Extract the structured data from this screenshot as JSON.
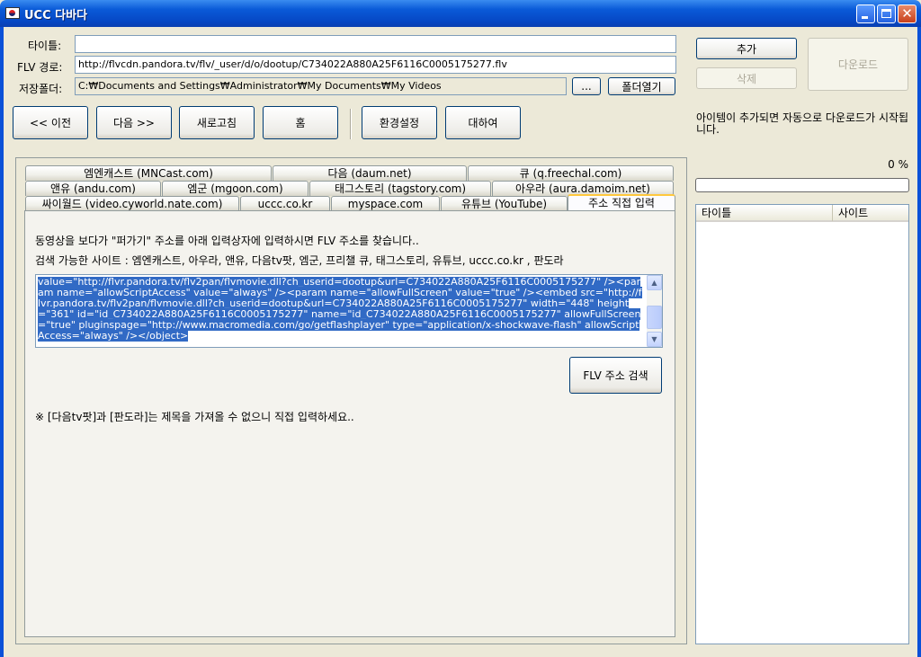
{
  "window": {
    "title": "UCC 다바다",
    "minimize_label": "",
    "maximize_label": "",
    "close_label": "✕"
  },
  "form": {
    "title_label": "타이틀:",
    "title_value": "",
    "flv_label": "FLV 경로:",
    "flv_value": "http://flvcdn.pandora.tv/flv/_user/d/o/dootup/C734022A880A25F6116C0005175277.flv",
    "folder_label": "저장폴더:",
    "folder_value": "C:₩Documents and Settings₩Administrator₩My Documents₩My Videos",
    "browse_label": "...",
    "open_folder_label": "폴더열기"
  },
  "right_panel": {
    "add_label": "추가",
    "delete_label": "삭제",
    "download_label": "다운로드",
    "info_text": "아이템이 추가되면 자동으로 다운로드가 시작됩니다.",
    "progress_text": "0 %",
    "progress_value": 0,
    "list_columns": [
      "타이틀",
      "사이트"
    ]
  },
  "nav": {
    "prev_label": "<< 이전",
    "next_label": "다음 >>",
    "refresh_label": "새로고침",
    "home_label": "홈",
    "settings_label": "환경설정",
    "about_label": "대하여"
  },
  "tabs": {
    "row1": [
      "엠엔캐스트 (MNCast.com)",
      "다음 (daum.net)",
      "큐 (q.freechal.com)"
    ],
    "row2": [
      "앤유 (andu.com)",
      "엠군 (mgoon.com)",
      "태그스토리 (tagstory.com)",
      "아우라 (aura.damoim.net)"
    ],
    "row3": [
      "싸이월드 (video.cyworld.nate.com)",
      "uccc.co.kr",
      "myspace.com",
      "유튜브 (YouTube)",
      "주소 직접 입력"
    ],
    "active": "주소 직접 입력"
  },
  "direct_input": {
    "instruction": "동영상을 보다가 \"퍼가기\" 주소를 아래 입력상자에 입력하시면 FLV 주소를 찾습니다..",
    "sites": "검색 가능한 사이트 : 엠엔캐스트, 아우라, 앤유, 다음tv팟, 엠군, 프리챌 큐, 태그스토리, 유튜브, uccc.co.kr , 판도라",
    "code_text": "value=\"http://flvr.pandora.tv/flv2pan/flvmovie.dll?ch_userid=dootup&url=C734022A880A25F6116C0005175277\" /><param name=\"allowScriptAccess\" value=\"always\" /><param name=\"allowFullScreen\" value=\"true\" /><embed src=\"http://flvr.pandora.tv/flv2pan/flvmovie.dll?ch_userid=dootup&url=C734022A880A25F6116C0005175277\" width=\"448\" height=\"361\" id=\"id_C734022A880A25F6116C0005175277\" name=\"id_C734022A880A25F6116C0005175277\" allowFullScreen=\"true\" pluginspage=\"http://www.macromedia.com/go/getflashplayer\" type=\"application/x-shockwave-flash\" allowScriptAccess=\"always\" /></object>",
    "search_label": "FLV 주소 검색",
    "note": "※ [다음tv팟]과 [판도라]는 제목을 가져올 수 없으니 직접 입력하세요.."
  }
}
